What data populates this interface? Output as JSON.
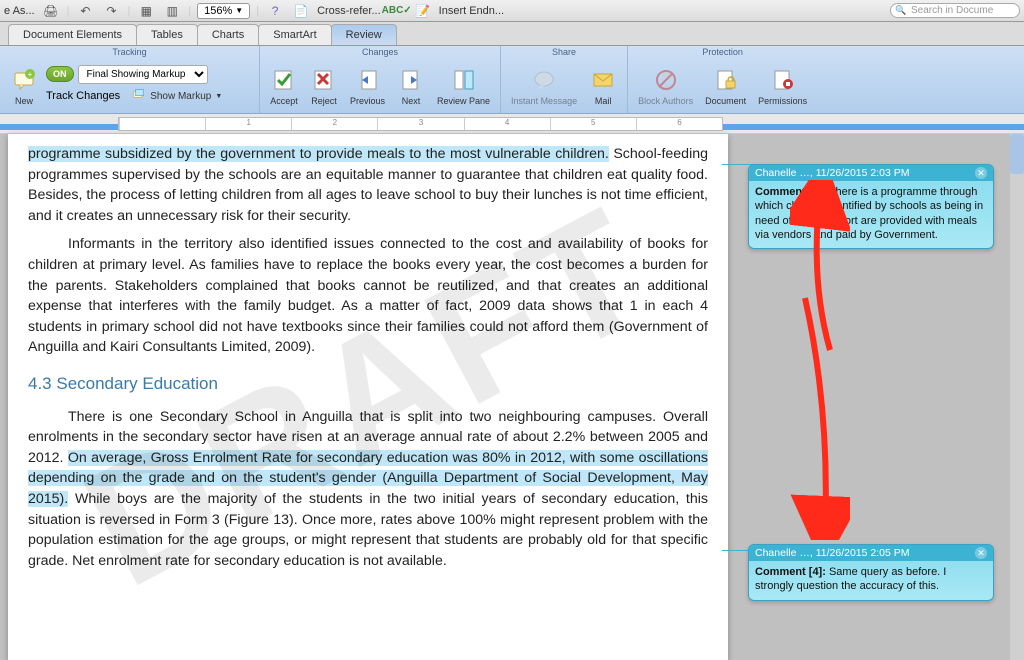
{
  "top": {
    "save_as": "e As...",
    "zoom": "156%",
    "cross_ref": "Cross-refer...",
    "insert_endnote": "Insert Endn...",
    "search_placeholder": "Search in Docume"
  },
  "tabs": [
    "Document Elements",
    "Tables",
    "Charts",
    "SmartArt",
    "Review"
  ],
  "active_tab": "Review",
  "ribbon": {
    "groups": {
      "tracking": {
        "title": "Tracking",
        "new": "New",
        "track_changes": "Track Changes",
        "toggle": "ON",
        "markup_mode": "Final Showing Markup",
        "show_markup": "Show Markup"
      },
      "changes": {
        "title": "Changes",
        "accept": "Accept",
        "reject": "Reject",
        "previous": "Previous",
        "next": "Next",
        "review_pane": "Review Pane"
      },
      "share": {
        "title": "Share",
        "im": "Instant Message",
        "mail": "Mail"
      },
      "protection": {
        "title": "Protection",
        "block_authors": "Block Authors",
        "document": "Document",
        "permissions": "Permissions"
      }
    }
  },
  "document": {
    "watermark": "DRAFT",
    "para1_hl": "programme subsidized by the government to provide meals to the most vulnerable children.",
    "para1_rest": " School-feeding programmes supervised by the schools are an equitable manner to guarantee that children eat quality food. Besides, the process of letting children from all ages to leave school to buy their lunches is not time efficient, and it creates an unnecessary risk for their security.",
    "para2": "Informants in the territory also identified issues connected to the cost and availability of books for children at primary level. As families have to replace the books every year, the cost becomes a burden for the parents. Stakeholders complained that books cannot be reutilized, and that creates an additional expense that interferes with the family budget. As a matter of fact, 2009 data shows that 1 in each 4 students in primary school did not have textbooks since their families could not afford them (Government of Anguilla and Kairi Consultants Limited, 2009).",
    "heading": "4.3 Secondary Education",
    "para3_a": "There is one Secondary School in Anguilla that is split into two neighbouring campuses. Overall enrolments in the secondary sector have risen at an average annual rate of about 2.2% between 2005 and 2012. ",
    "para3_hl": "On average, Gross Enrolment Rate for secondary education was 80% in 2012, with some oscillations depending on the grade and on the student's gender (Anguilla Department of Social Development, May 2015).",
    "para3_b": " While boys are the majority of the students in the two initial years of secondary education, this situation is reversed in Form 3 (Figure 13). Once more, rates above 100% might represent problem with the population estimation for the age groups, or might represent that students are probably old for that specific grade. Net enrolment rate for secondary education is not available."
  },
  "comments": [
    {
      "author": "Chanelle …,",
      "timestamp": "11/26/2015 2:03 PM",
      "label": "Comment [3]:",
      "text": "There is a programme through which children identified by schools as being in need of such support are provided with meals via vendors and paid by Government."
    },
    {
      "author": "Chanelle …,",
      "timestamp": "11/26/2015 2:05 PM",
      "label": "Comment [4]:",
      "text": "Same query as before.  I strongly question the accuracy of this."
    }
  ]
}
